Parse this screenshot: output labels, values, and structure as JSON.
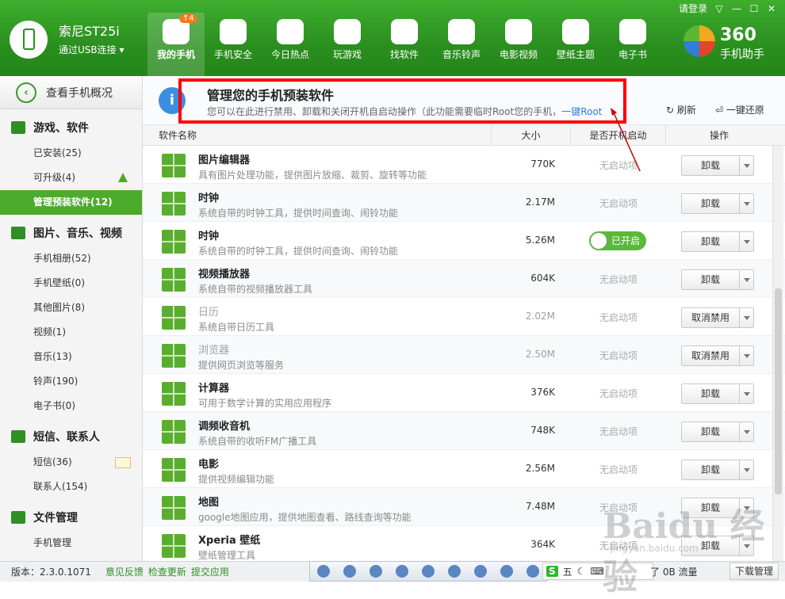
{
  "window": {
    "login": "请登录",
    "controls": [
      "▽",
      "—",
      "☐",
      "✕"
    ]
  },
  "device": {
    "name": "索尼ST25i",
    "connection": "通过USB连接"
  },
  "nav": {
    "items": [
      {
        "label": "我的手机",
        "badge": "4",
        "icon": "phone-icon"
      },
      {
        "label": "手机安全",
        "icon": "shield-icon"
      },
      {
        "label": "今日热点",
        "icon": "star-icon"
      },
      {
        "label": "玩游戏",
        "icon": "gamepad-icon"
      },
      {
        "label": "找软件",
        "icon": "store-icon"
      },
      {
        "label": "音乐铃声",
        "icon": "music-icon"
      },
      {
        "label": "电影视频",
        "icon": "film-icon"
      },
      {
        "label": "壁纸主题",
        "icon": "picture-icon"
      },
      {
        "label": "电子书",
        "icon": "book-icon"
      }
    ]
  },
  "logo": {
    "number": "360",
    "text": "手机助手"
  },
  "sidebar": {
    "overview": "查看手机概况",
    "sections": [
      {
        "title": "游戏、软件",
        "items": [
          "已安装(25)",
          "可升级(4)",
          "管理预装软件(12)"
        ]
      },
      {
        "title": "图片、音乐、视频",
        "items": [
          "手机相册(52)",
          "手机壁纸(0)",
          "其他图片(8)",
          "视频(1)",
          "音乐(13)",
          "铃声(190)",
          "电子书(0)"
        ]
      },
      {
        "title": "短信、联系人",
        "items": [
          "短信(36)",
          "联系人(154)"
        ]
      },
      {
        "title": "文件管理",
        "items": [
          "手机管理"
        ]
      }
    ]
  },
  "header": {
    "title": "管理您的手机预装软件",
    "description": "您可以在此进行禁用、卸载和关闭开机自启动操作（此功能需要临时Root您的手机，",
    "root_link": "一键Root",
    "refresh": "刷新",
    "restore": "一键还原"
  },
  "table": {
    "columns": [
      "软件名称",
      "大小",
      "是否开机启动",
      "操作"
    ],
    "rows": [
      {
        "name": "图片编辑器",
        "desc": "具有图片处理功能，提供图片放缩、裁剪、旋转等功能",
        "size": "770K",
        "boot": "无启动项",
        "action": "卸载",
        "disabled": false
      },
      {
        "name": "时钟",
        "desc": "系统自带的时钟工具，提供时间查询、闹铃功能",
        "size": "2.17M",
        "boot": "无启动项",
        "action": "卸载",
        "disabled": false
      },
      {
        "name": "时钟",
        "desc": "系统自带的时钟工具，提供时间查询、闹铃功能",
        "size": "5.26M",
        "boot": "已开启",
        "action": "卸载",
        "disabled": false
      },
      {
        "name": "视频播放器",
        "desc": "系统自带的视频播放器工具",
        "size": "604K",
        "boot": "无启动项",
        "action": "卸载",
        "disabled": false
      },
      {
        "name": "日历",
        "desc": "系统自带日历工具",
        "size": "2.02M",
        "boot": "无启动项",
        "action": "取消禁用",
        "disabled": true
      },
      {
        "name": "浏览器",
        "desc": "提供网页浏览等服务",
        "size": "2.50M",
        "boot": "无启动项",
        "action": "取消禁用",
        "disabled": true
      },
      {
        "name": "计算器",
        "desc": "可用于数学计算的实用应用程序",
        "size": "376K",
        "boot": "无启动项",
        "action": "卸载",
        "disabled": false
      },
      {
        "name": "调频收音机",
        "desc": "系统自带的收听FM广播工具",
        "size": "748K",
        "boot": "无启动项",
        "action": "卸载",
        "disabled": false
      },
      {
        "name": "电影",
        "desc": "提供视频编辑功能",
        "size": "2.56M",
        "boot": "无启动项",
        "action": "卸载",
        "disabled": false
      },
      {
        "name": "地图",
        "desc": "google地图应用，提供地图查看、路线查询等功能",
        "size": "7.48M",
        "boot": "无启动项",
        "action": "卸载",
        "disabled": false
      },
      {
        "name": "Xperia 壁纸",
        "desc": "壁纸管理工具",
        "size": "364K",
        "boot": "无启动项",
        "action": "卸载",
        "disabled": false
      }
    ]
  },
  "status": {
    "version": "版本：2.3.0.1071",
    "links": [
      "意见反馈",
      "检查更新",
      "提交应用"
    ],
    "ime_label": "五",
    "flow": "了 0B 流量",
    "download": "下载管理"
  },
  "watermark": {
    "text": "Baidu 经验",
    "url": "jingyan.baidu.com"
  }
}
